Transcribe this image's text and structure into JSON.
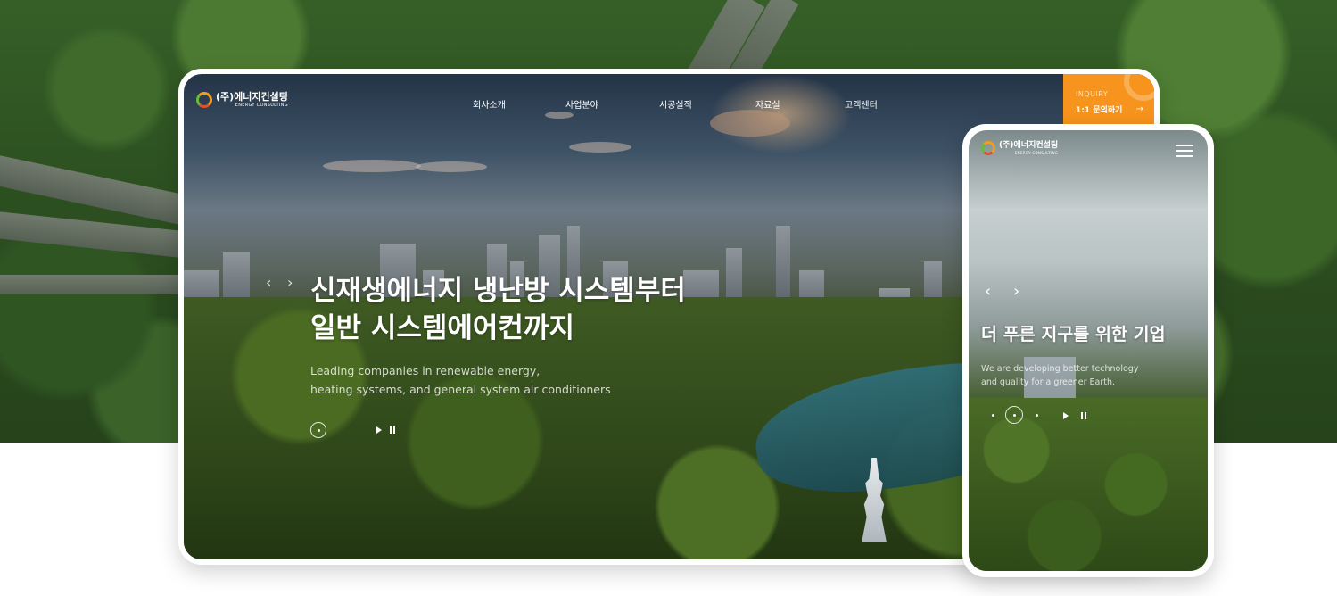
{
  "desktop": {
    "logo": {
      "name_kr": "(주)에너지컨설팅",
      "name_en": "ENERGY CONSULTING"
    },
    "nav": [
      "회사소개",
      "사업분야",
      "시공실적",
      "자료실",
      "고객센터"
    ],
    "inquiry": {
      "label": "INQUIRY",
      "text": "1:1 문의하기",
      "arrow": "→"
    },
    "slider": {
      "prev": "‹",
      "next": "›",
      "headline": [
        "신재생에너지 냉난방 시스템부터",
        "일반 시스템에어컨까지"
      ],
      "subtext": [
        "Leading companies in renewable energy,",
        "heating systems, and general system air conditioners"
      ]
    }
  },
  "mobile": {
    "logo": {
      "name_kr": "(주)에너지컨설팅",
      "name_en": "ENERGY CONSULTING"
    },
    "slider": {
      "prev": "‹",
      "next": "›",
      "headline": "더 푸른 지구를 위한 기업",
      "subtext": [
        "We are developing better technology",
        "and quality for a greener Earth."
      ]
    }
  },
  "colors": {
    "accent": "#f7941d",
    "frame": "#ffffff"
  },
  "icons": [
    "logo-mark-icon",
    "arrow-right-icon",
    "chevron-left-icon",
    "chevron-right-icon",
    "play-icon",
    "pause-icon",
    "hamburger-menu-icon"
  ]
}
